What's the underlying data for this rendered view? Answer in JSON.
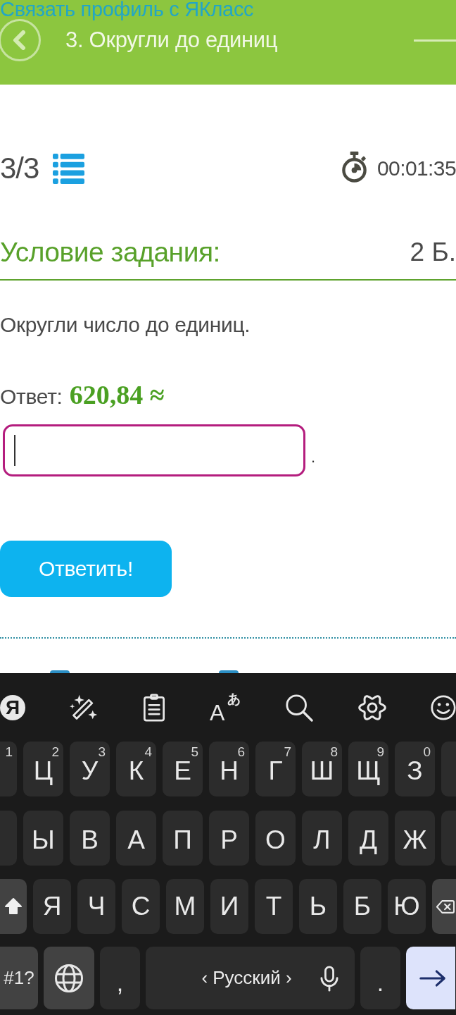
{
  "header": {
    "link": "Связать профиль с ЯКласс",
    "title": "3. Округли до единиц"
  },
  "quiz_bar": {
    "counter": "3/3",
    "timer": "00:01:35"
  },
  "task": {
    "heading": "Условие задания:",
    "points": "2 Б.",
    "instruction": "Округли число до единиц.",
    "answer_label": "Ответ:",
    "expression": "620,84 ≈",
    "answer_field": {
      "focused": true
    },
    "after_field": "."
  },
  "submit_button": "Ответить!",
  "keyboard": {
    "toolbar": [
      {
        "kind": "logo",
        "label": "Я"
      },
      {
        "kind": "wand"
      },
      {
        "kind": "clipboard"
      },
      {
        "kind": "translate",
        "label": "A",
        "sub": "あ"
      },
      {
        "kind": "search"
      },
      {
        "kind": "settings"
      },
      {
        "kind": "emoji"
      }
    ],
    "rows": [
      [
        {
          "kind": "edge",
          "hint": "1"
        },
        {
          "kind": "letter",
          "label": "Ц",
          "hint": "2"
        },
        {
          "kind": "letter",
          "label": "У",
          "hint": "3"
        },
        {
          "kind": "letter",
          "label": "К",
          "hint": "4"
        },
        {
          "kind": "letter",
          "label": "Е",
          "hint": "5"
        },
        {
          "kind": "letter",
          "label": "Н",
          "hint": "6"
        },
        {
          "kind": "letter",
          "label": "Г",
          "hint": "7"
        },
        {
          "kind": "letter",
          "label": "Ш",
          "hint": "8"
        },
        {
          "kind": "letter",
          "label": "Щ",
          "hint": "9"
        },
        {
          "kind": "letter",
          "label": "З",
          "hint": "0"
        },
        {
          "kind": "edge"
        }
      ],
      [
        {
          "kind": "edge"
        },
        {
          "kind": "letter",
          "label": "Ы"
        },
        {
          "kind": "letter",
          "label": "В"
        },
        {
          "kind": "letter",
          "label": "А"
        },
        {
          "kind": "letter",
          "label": "П"
        },
        {
          "kind": "letter",
          "label": "Р"
        },
        {
          "kind": "letter",
          "label": "О"
        },
        {
          "kind": "letter",
          "label": "Л"
        },
        {
          "kind": "letter",
          "label": "Д"
        },
        {
          "kind": "letter",
          "label": "Ж"
        },
        {
          "kind": "edge"
        }
      ],
      [
        {
          "kind": "shift",
          "on": true
        },
        {
          "kind": "letter",
          "label": "Я"
        },
        {
          "kind": "letter",
          "label": "Ч"
        },
        {
          "kind": "letter",
          "label": "С"
        },
        {
          "kind": "letter",
          "label": "М"
        },
        {
          "kind": "letter",
          "label": "И"
        },
        {
          "kind": "letter",
          "label": "Т"
        },
        {
          "kind": "letter",
          "label": "Ь"
        },
        {
          "kind": "letter",
          "label": "Б"
        },
        {
          "kind": "letter",
          "label": "Ю"
        },
        {
          "kind": "backspace"
        }
      ]
    ],
    "bottom_row": [
      {
        "kind": "symbols",
        "label": "#1?"
      },
      {
        "kind": "globe"
      },
      {
        "kind": "char",
        "label": ","
      },
      {
        "kind": "space",
        "label": "‹ Русский ›"
      },
      {
        "kind": "char",
        "label": "."
      },
      {
        "kind": "enter"
      }
    ]
  }
}
